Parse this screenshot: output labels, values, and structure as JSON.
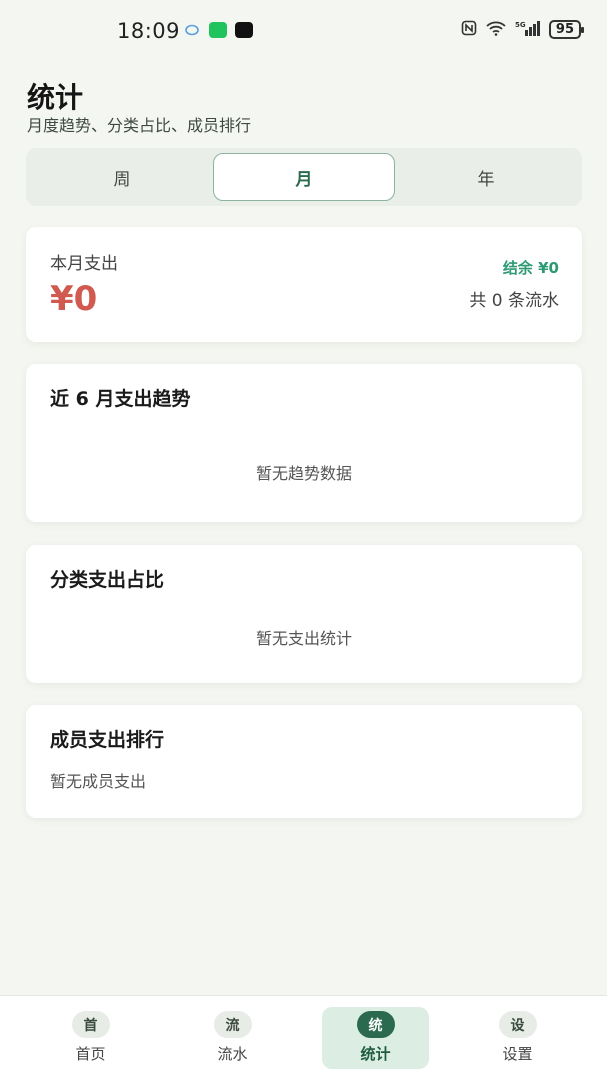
{
  "status_bar": {
    "time": "18:09",
    "battery": "95",
    "signal": "5G"
  },
  "header": {
    "title": "统计",
    "subtitle": "月度趋势、分类占比、成员排行"
  },
  "period_tabs": [
    {
      "label": "周",
      "selected": false
    },
    {
      "label": "月",
      "selected": true
    },
    {
      "label": "年",
      "selected": false
    }
  ],
  "summary": {
    "label": "本月支出",
    "amount": "¥0",
    "balance": "结余 ¥0",
    "count": "共 0 条流水"
  },
  "trend_card": {
    "title": "近 6 月支出趋势",
    "empty_text": "暂无趋势数据"
  },
  "category_card": {
    "title": "分类支出占比",
    "empty_text": "暂无支出统计"
  },
  "members_card": {
    "title": "成员支出排行",
    "empty_text": "暂无成员支出"
  },
  "bottom_nav": [
    {
      "badge": "首",
      "label": "首页",
      "active": false
    },
    {
      "badge": "流",
      "label": "流水",
      "active": false
    },
    {
      "badge": "统",
      "label": "统计",
      "active": true
    },
    {
      "badge": "设",
      "label": "设置",
      "active": false
    }
  ],
  "colors": {
    "accent": "#2b6a4f",
    "expense": "#d05a4f",
    "balance": "#2e9a74",
    "background": "#f4f6f1"
  }
}
